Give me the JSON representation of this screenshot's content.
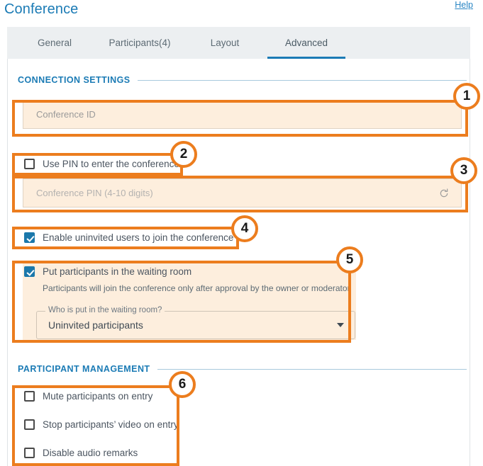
{
  "header": {
    "title": "Conference",
    "help_label": "Help"
  },
  "tabs": [
    {
      "label": "General",
      "active": false
    },
    {
      "label": "Participants(4)",
      "active": false
    },
    {
      "label": "Layout",
      "active": false
    },
    {
      "label": "Advanced",
      "active": true
    }
  ],
  "sections": {
    "connection": {
      "title": "CONNECTION SETTINGS",
      "conference_id": {
        "placeholder": "Conference ID",
        "value": ""
      },
      "use_pin": {
        "label": "Use PIN to enter the conference",
        "checked": false
      },
      "conference_pin": {
        "placeholder": "Conference PIN (4-10 digits)",
        "value": "",
        "refresh_icon": "refresh-icon"
      },
      "enable_uninvited": {
        "label": "Enable uninvited users to join the conference",
        "checked": true
      },
      "waiting_room": {
        "label": "Put participants in the waiting room",
        "checked": true,
        "hint": "Participants will join the conference only after approval by the owner or moderator",
        "select": {
          "label": "Who is put in the waiting room?",
          "value": "Uninvited participants",
          "caret_icon": "chevron-down-icon"
        }
      }
    },
    "participant_management": {
      "title": "PARTICIPANT MANAGEMENT",
      "options": [
        {
          "label": "Mute participants on entry",
          "checked": false
        },
        {
          "label": "Stop participants’ video on entry",
          "checked": false
        },
        {
          "label": "Disable audio remarks",
          "checked": false
        }
      ]
    }
  },
  "annotations": [
    {
      "number": "1"
    },
    {
      "number": "2"
    },
    {
      "number": "3"
    },
    {
      "number": "4"
    },
    {
      "number": "5"
    },
    {
      "number": "6"
    }
  ],
  "colors": {
    "accent_blue": "#1b7bb5",
    "annotation_orange": "#ec7d1e",
    "highlight_fill": "#fdeedd",
    "checkbox_checked": "#1b78ab",
    "tabbar_bg": "#eceff1"
  }
}
